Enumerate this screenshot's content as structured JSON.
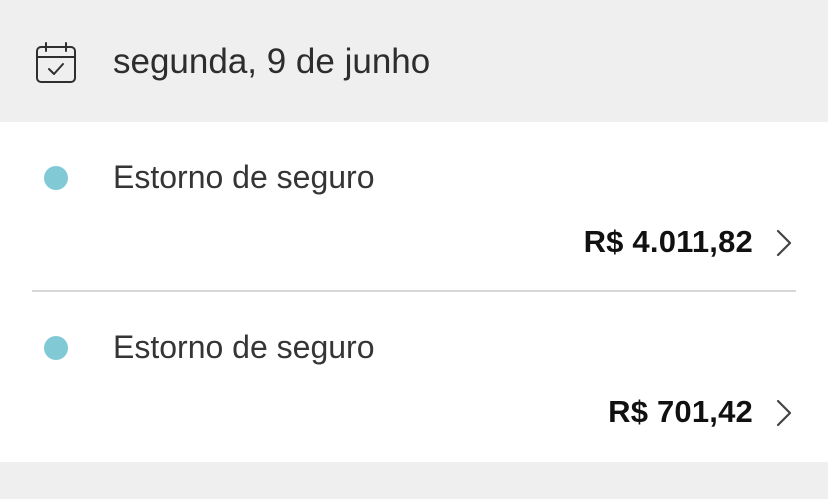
{
  "header": {
    "date": "segunda, 9 de junho",
    "icon": "calendar-check-icon"
  },
  "transactions": [
    {
      "description": "Estorno de seguro",
      "amount": "R$ 4.011,82",
      "dot_color": "#80c9d5"
    },
    {
      "description": "Estorno de seguro",
      "amount": "R$ 701,42",
      "dot_color": "#80c9d5"
    }
  ],
  "icons": {
    "row_action": "chevron-right-icon",
    "status": "dot-icon"
  }
}
